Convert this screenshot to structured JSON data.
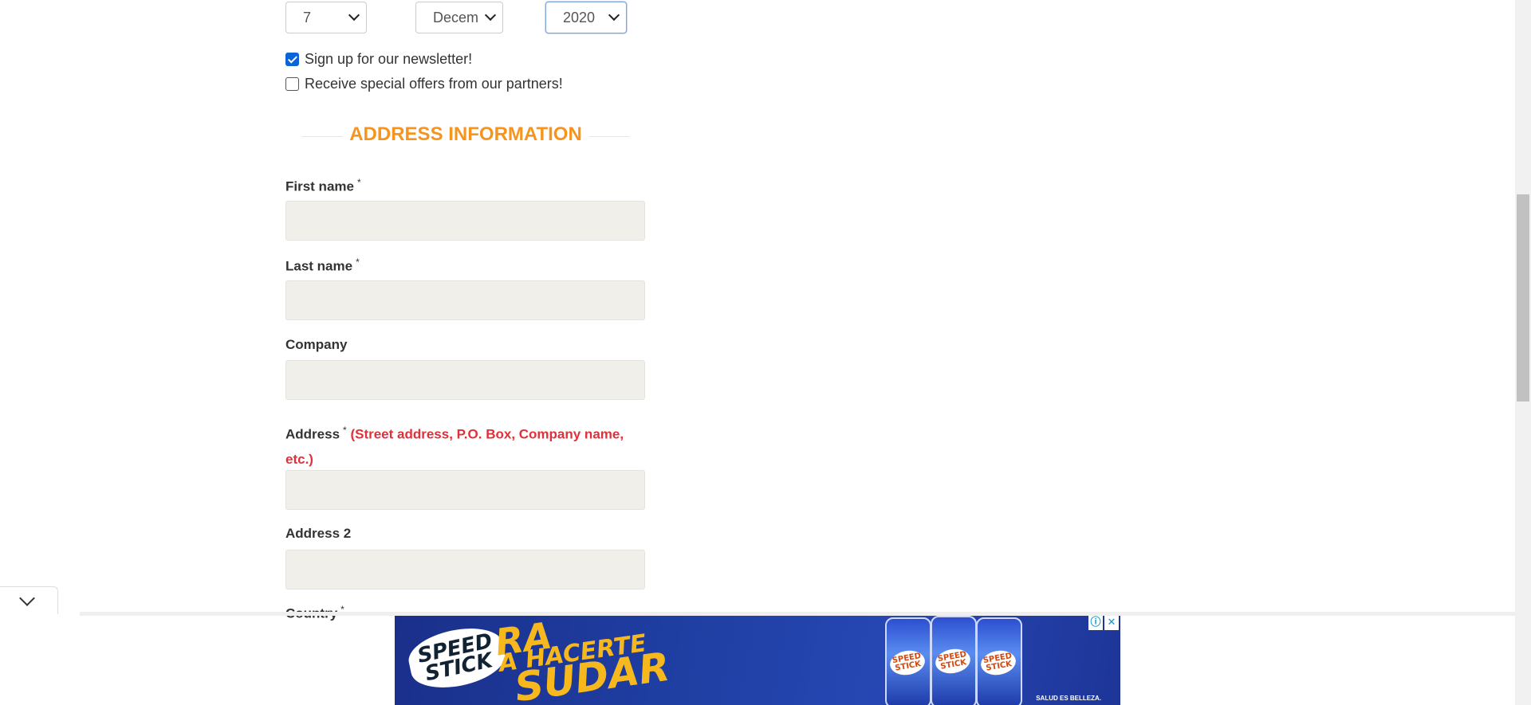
{
  "dob": {
    "day": "7",
    "month": "Decem",
    "year": "2020"
  },
  "checkboxes": {
    "newsletter": {
      "label": "Sign up for our newsletter!",
      "checked": true
    },
    "offers": {
      "label": "Receive special offers from our partners!",
      "checked": false
    }
  },
  "section": {
    "title": "ADDRESS INFORMATION"
  },
  "fields": {
    "first_name": {
      "label": "First name",
      "required": "*"
    },
    "last_name": {
      "label": "Last name",
      "required": "*"
    },
    "company": {
      "label": "Company"
    },
    "address": {
      "label": "Address",
      "required": "*",
      "hint_line1": "(Street address, P.O. Box, Company name,",
      "hint_line2": "etc.)"
    },
    "address2": {
      "label": "Address 2"
    },
    "country": {
      "label": "Country",
      "required": "*"
    }
  },
  "ad": {
    "brand": "SPEED STICK",
    "headline_part1": "RA",
    "headline_part2": "A HACERTE",
    "headline_part3": "SUDAR",
    "product_label": "SPEED STICK",
    "tagline": "SALUD ES BELLEZA.",
    "info_icon": "ⓘ",
    "close_icon": "✕"
  },
  "colors": {
    "accent": "#f7941d",
    "hint_red": "#e0303a",
    "field_bg": "#f0efe9",
    "checkbox_blue": "#0a64d8"
  }
}
